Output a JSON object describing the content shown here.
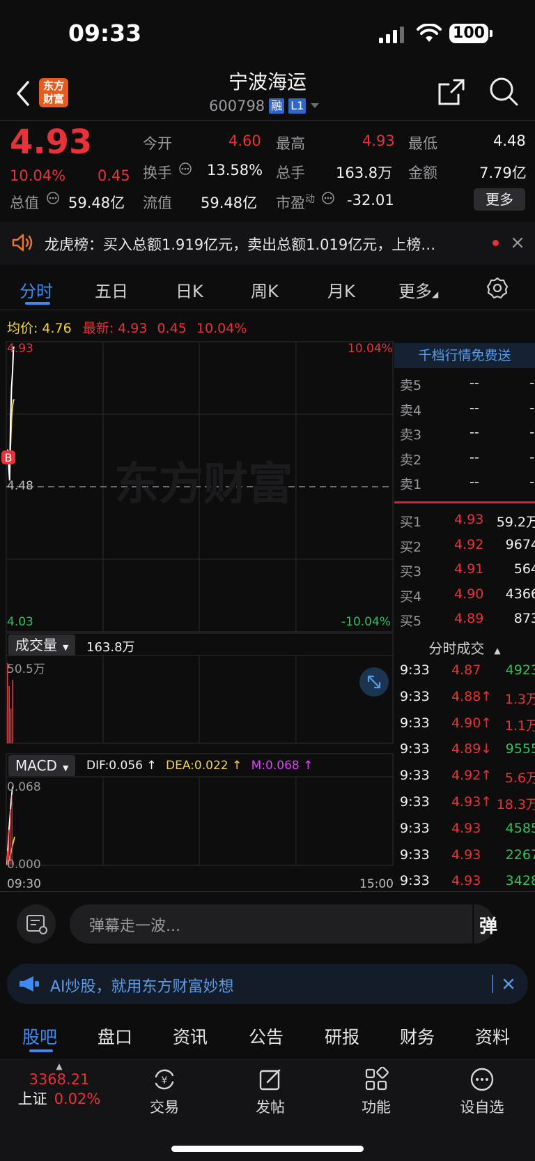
{
  "status": {
    "time": "09:33",
    "battery": "100"
  },
  "header": {
    "logo_line1": "东方",
    "logo_line2": "财富",
    "name": "宁波海运",
    "code": "600798",
    "tag_rong": "融",
    "tag_level": "L1"
  },
  "quote": {
    "price": "4.93",
    "change_pct": "10.04%",
    "change": "0.45",
    "open_label": "今开",
    "open": "4.60",
    "high_label": "最高",
    "high": "4.93",
    "low_label": "最低",
    "low": "4.48",
    "turnover_label": "换手",
    "turnover": "13.58%",
    "volume_label": "总手",
    "volume": "163.8万",
    "amount_label": "金额",
    "amount": "7.79亿",
    "mktcap_label": "总值",
    "mktcap": "59.48亿",
    "float_label": "流值",
    "float": "59.48亿",
    "pe_label": "市盈",
    "pe_sup": "动",
    "pe": "-32.01",
    "more": "更多"
  },
  "notice": {
    "text": "龙虎榜：买入总额1.919亿元，卖出总额1.019亿元，上榜…"
  },
  "chart_tabs": [
    "分时",
    "五日",
    "日K",
    "周K",
    "月K",
    "更多"
  ],
  "chart_info": {
    "avg_label": "均价:",
    "avg": "4.76",
    "latest_label": "最新:",
    "latest": "4.93",
    "latest_change": "0.45",
    "latest_pct": "10.04%"
  },
  "chart_data": {
    "type": "line",
    "ylim": [
      4.03,
      4.93
    ],
    "y_tick_top": "4.93",
    "y_tick_mid": "4.48",
    "y_tick_bottom": "4.03",
    "pct_top": "10.04%",
    "pct_bottom": "-10.04%",
    "x_start": "09:30",
    "x_end": "15:00",
    "watermark": "东方财富",
    "buy_marker": "B",
    "price_series": [
      4.6,
      4.55,
      4.5,
      4.7,
      4.8,
      4.85,
      4.93,
      4.93
    ],
    "avg_series": [
      4.6,
      4.56,
      4.55,
      4.62,
      4.7,
      4.74,
      4.76,
      4.76
    ],
    "volume_label": "成交量",
    "volume_total": "163.8万",
    "volume_max": "50.5万",
    "volume_bars": [
      50.5,
      36,
      22,
      40
    ],
    "macd_label": "MACD",
    "dif": "DIF:0.056 ↑",
    "dea": "DEA:0.022 ↑",
    "m": "M:0.068 ↑",
    "macd_max": "0.068",
    "macd_min": "0.000"
  },
  "order_book": {
    "banner": "千档行情免费送",
    "asks": [
      {
        "label": "卖5",
        "price": "--",
        "vol": "--"
      },
      {
        "label": "卖4",
        "price": "--",
        "vol": "--"
      },
      {
        "label": "卖3",
        "price": "--",
        "vol": "--"
      },
      {
        "label": "卖2",
        "price": "--",
        "vol": "--"
      },
      {
        "label": "卖1",
        "price": "--",
        "vol": "--"
      }
    ],
    "bids": [
      {
        "label": "买1",
        "price": "4.93",
        "vol": "59.2万"
      },
      {
        "label": "买2",
        "price": "4.92",
        "vol": "9674"
      },
      {
        "label": "买3",
        "price": "4.91",
        "vol": "564"
      },
      {
        "label": "买4",
        "price": "4.90",
        "vol": "4366"
      },
      {
        "label": "买5",
        "price": "4.89",
        "vol": "873"
      }
    ],
    "ticks_title": "分时成交",
    "ticks": [
      {
        "time": "9:33",
        "price": "4.87",
        "arrow": "",
        "vol": "4923",
        "color": "green"
      },
      {
        "time": "9:33",
        "price": "4.88↑",
        "arrow": "up",
        "vol": "1.3万",
        "color": "red"
      },
      {
        "time": "9:33",
        "price": "4.90↑",
        "arrow": "up",
        "vol": "1.1万",
        "color": "red"
      },
      {
        "time": "9:33",
        "price": "4.89↓",
        "arrow": "down",
        "vol": "9555",
        "color": "green"
      },
      {
        "time": "9:33",
        "price": "4.92↑",
        "arrow": "up",
        "vol": "5.6万",
        "color": "red"
      },
      {
        "time": "9:33",
        "price": "4.93↑",
        "arrow": "up",
        "vol": "18.3万",
        "color": "red"
      },
      {
        "time": "9:33",
        "price": "4.93",
        "arrow": "",
        "vol": "4585",
        "color": "green"
      },
      {
        "time": "9:33",
        "price": "4.93",
        "arrow": "",
        "vol": "2267",
        "color": "green"
      },
      {
        "time": "9:33",
        "price": "4.93",
        "arrow": "",
        "vol": "3428",
        "color": "green"
      }
    ]
  },
  "danmu": {
    "placeholder": "弹幕走一波...",
    "send": "弹"
  },
  "ai_banner": {
    "text": "AI炒股，就用东方财富妙想"
  },
  "bottom_tabs": [
    "股吧",
    "盘口",
    "资讯",
    "公告",
    "研报",
    "财务",
    "资料"
  ],
  "nav": {
    "index_value": "3368.21",
    "index_name": "上证",
    "index_pct": "0.02%",
    "trade": "交易",
    "post": "发帖",
    "func": "功能",
    "watch": "设自选"
  },
  "colors": {
    "up": "#e8323a",
    "down": "#2fc25b",
    "accent": "#3d8bf2",
    "avg_line": "#f0d24a"
  }
}
